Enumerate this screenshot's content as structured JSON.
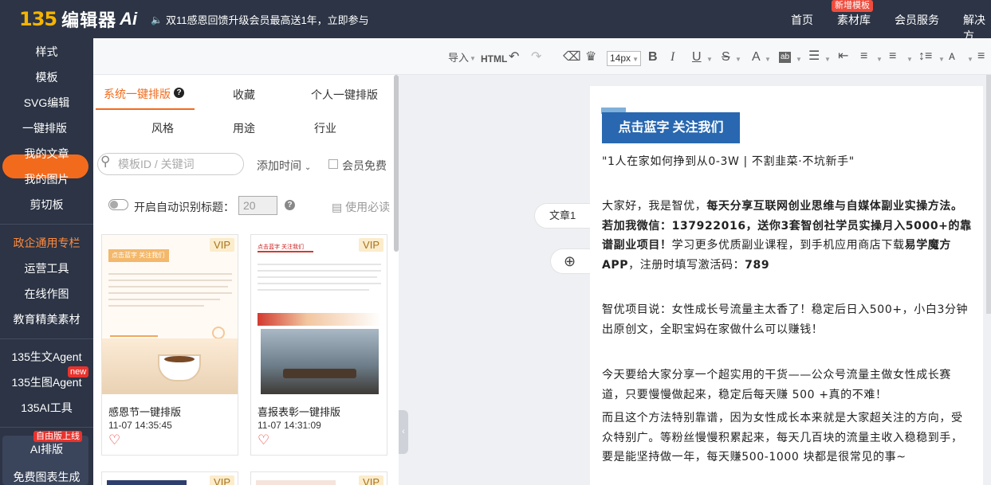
{
  "header": {
    "logo_num": "135",
    "logo_name": "编辑器",
    "logo_ai": "Ai",
    "announcement": "双11感恩回馈升级会员最高送1年，立即参与",
    "nav": [
      "首页",
      "素材库",
      "会员服务",
      "解决方"
    ],
    "nav_badge": "新增模板"
  },
  "sidebar": {
    "items": [
      "样式",
      "模板",
      "SVG编辑",
      "一键排版",
      "我的文章",
      "我的图片",
      "剪切板",
      "政企通用专栏",
      "运营工具",
      "在线作图",
      "教育精美素材",
      "135生文Agent",
      "135生图Agent",
      "135AI工具",
      "AI排版",
      "免费图表生成"
    ],
    "active_index": 3,
    "badge_new": "new",
    "badge_free": "自由版上线"
  },
  "toolbar": {
    "import_label": "导入",
    "html_label": "HTML",
    "font_size": "14px",
    "bold": "B",
    "italic": "I",
    "underline": "U",
    "strike": "S",
    "color": "A"
  },
  "panel": {
    "tabs": [
      "系统一键排版",
      "收藏",
      "个人一键排版"
    ],
    "filters": [
      "风格",
      "用途",
      "行业"
    ],
    "search_placeholder": "模板ID / 关键词",
    "sort_label": "添加时间",
    "member_free": "会员免费",
    "auto_title_label": "开启自动识别标题：",
    "auto_title_value": "20",
    "must_read": "使用必读",
    "templates": [
      {
        "name": "感恩节一键排版",
        "time": "11-07 14:35:45",
        "badge": "VIP",
        "banner": "点击蓝字 关注我们"
      },
      {
        "name": "喜报表彰一键排版",
        "time": "11-07 14:31:09",
        "badge": "VIP",
        "banner": "点击蓝字 关注我们"
      }
    ],
    "more_badges": [
      "VIP",
      "VIP"
    ]
  },
  "canvas": {
    "article_tab": "文章1",
    "add_icon": "plus-circle-icon"
  },
  "editor": {
    "banner": "点击蓝字 关注我们",
    "p1": "\"1人在家如何挣到从0-3W | 不割韭菜·不坑新手\"",
    "p2_a": "大家好，我是智优，",
    "p2_b": "每天分享互联网创业思维与自媒体副业实操方法。若加我微信：137922016，送你3套智创社学员实操月入5000+的靠谱副业项目！",
    "p2_c": "学习更多优质副业课程，到手机应用商店下载",
    "p2_d": "易学魔方APP",
    "p2_e": "，注册时填写激活码：",
    "p2_f": "789",
    "p3": "智优项目说：女性成长号流量主太香了！稳定后日入500+，小白3分钟出原创文，全职宝妈在家做什么可以赚钱！",
    "p4": "今天要给大家分享一个超实用的干货——公众号流量主做女性成长赛道，只要慢慢做起来，稳定后每天赚 500 +真的不难！",
    "p5": "而且这个方法特别靠谱，因为女性成长本来就是大家超关注的方向，受众特别广。等粉丝慢慢积累起来，每天几百块的流量主收入稳稳到手，要是能坚持做一年，每天赚500-1000 块都是很常见的事~"
  },
  "colors": {
    "topbar": "#2c3445",
    "accent": "#f26b1d",
    "banner_blue": "#2968b0",
    "badge_red": "#e8332d"
  }
}
